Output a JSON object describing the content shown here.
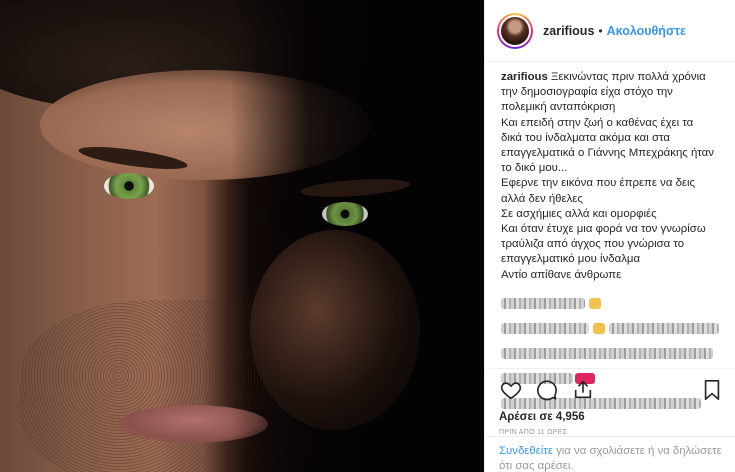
{
  "post": {
    "author": "zarifious",
    "header_separator": "•",
    "follow_label": "Ακολουθήστε",
    "caption_lines": [
      "Ξεκινώντας πριν πολλά χρόνια",
      "την δημοσιογραφία είχα στόχο την",
      "πολεμική ανταπόκριση",
      "Και επειδή στην ζωή ο καθένας έχει τα",
      "δικά του ίνδαλματα ακόμα και στα",
      "επαγγελματικά ο Γιάννης Μπεχράκης ήταν",
      "το δικό μου...",
      "Εφερνε την εικόνα που έπρεπε να δεις",
      "αλλά δεν ήθελες",
      "Σε ασχήμιες αλλά και ομορφιές",
      "Και όταν έτυχε μια φορά να τον γνωρίσω",
      "τραύλιζα από άγχος που γνώρισα το",
      "επαγγελματικό μου ίνδαλμα",
      "Αντίο απίθανε άνθρωπε"
    ],
    "likes_text": "Αρέσει σε 4,956",
    "timestamp": "ΠΡΙΝ ΑΠΟ 11 ΩΡΕΣ"
  },
  "actions": {
    "like_icon": "heart-icon",
    "comment_icon": "comment-icon",
    "share_icon": "share-icon",
    "save_icon": "bookmark-icon"
  },
  "login_prompt": {
    "link": "Συνδεθείτε",
    "text": " για να σχολιάσετε ή να δηλώσετε ότι σας αρέσει."
  },
  "colors": {
    "accent": "#3897f0",
    "text": "#262626",
    "muted": "#999999",
    "divider": "#efefef"
  }
}
